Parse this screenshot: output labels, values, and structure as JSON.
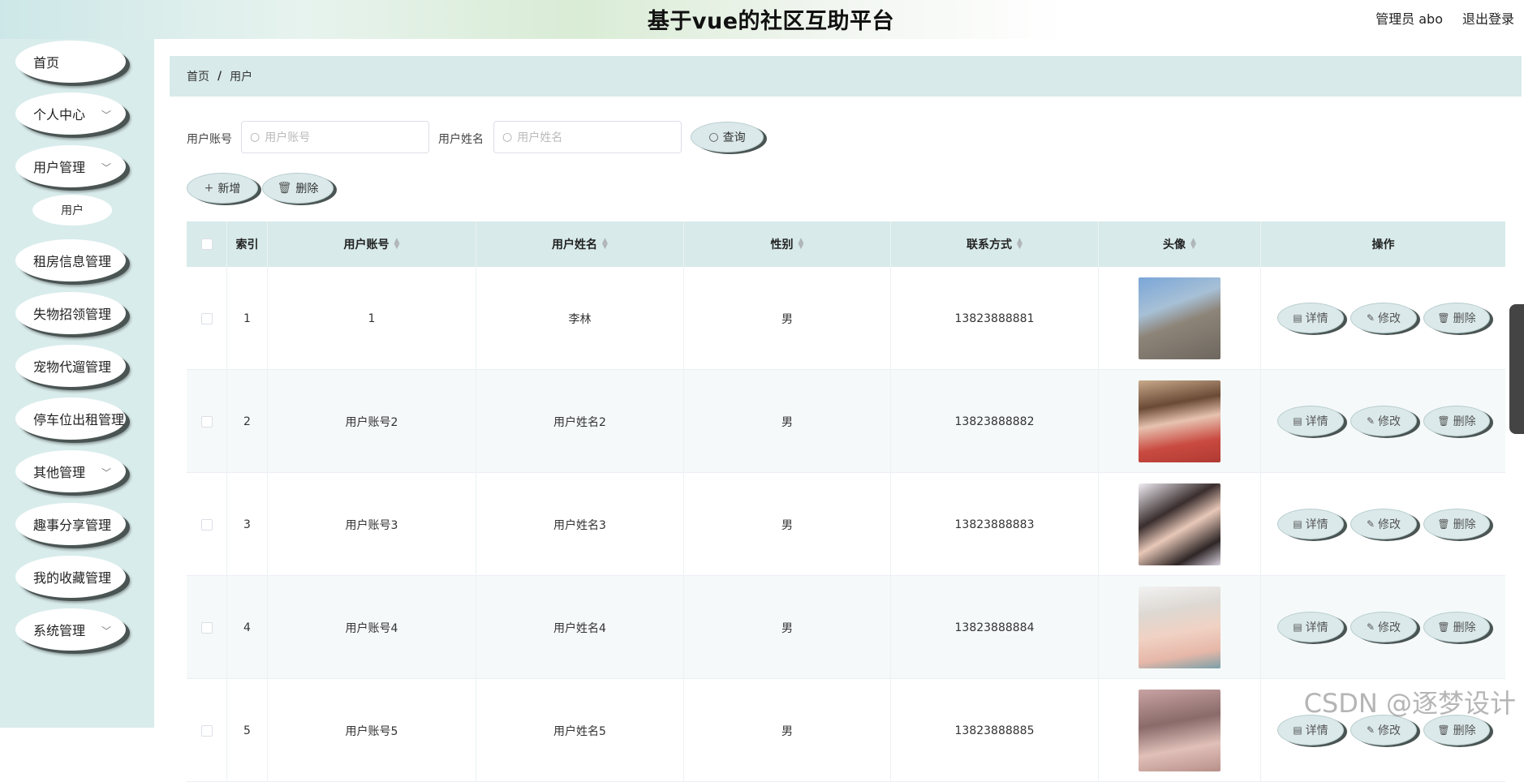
{
  "header": {
    "title": "基于vue的社区互助平台",
    "user": "管理员 abo",
    "logout": "退出登录"
  },
  "sidebar": {
    "items": [
      {
        "label": "首页"
      },
      {
        "label": "个人中心"
      },
      {
        "label": "用户管理"
      },
      {
        "label": "用户"
      },
      {
        "label": "租房信息管理"
      },
      {
        "label": "失物招领管理"
      },
      {
        "label": "宠物代遛管理"
      },
      {
        "label": "停车位出租管理"
      },
      {
        "label": "其他管理"
      },
      {
        "label": "趣事分享管理"
      },
      {
        "label": "我的收藏管理"
      },
      {
        "label": "系统管理"
      }
    ]
  },
  "breadcrumb": {
    "home": "首页",
    "sep": "/",
    "current": "用户"
  },
  "search": {
    "account_label": "用户账号",
    "account_placeholder": "用户账号",
    "name_label": "用户姓名",
    "name_placeholder": "用户姓名",
    "query_label": "查询"
  },
  "actions": {
    "add_label": "新增",
    "delete_label": "删除"
  },
  "table": {
    "headers": [
      "索引",
      "用户账号",
      "用户姓名",
      "性别",
      "联系方式",
      "头像",
      "操作"
    ],
    "rows": [
      {
        "index": "1",
        "account": "1",
        "name": "李林",
        "gender": "男",
        "phone": "13823888881"
      },
      {
        "index": "2",
        "account": "用户账号2",
        "name": "用户姓名2",
        "gender": "男",
        "phone": "13823888882"
      },
      {
        "index": "3",
        "account": "用户账号3",
        "name": "用户姓名3",
        "gender": "男",
        "phone": "13823888883"
      },
      {
        "index": "4",
        "account": "用户账号4",
        "name": "用户姓名4",
        "gender": "男",
        "phone": "13823888884"
      },
      {
        "index": "5",
        "account": "用户账号5",
        "name": "用户姓名5",
        "gender": "男",
        "phone": "13823888885"
      }
    ],
    "ops": {
      "detail": "详情",
      "edit": "修改",
      "delete": "删除"
    }
  },
  "watermark": "CSDN @逐梦设计"
}
